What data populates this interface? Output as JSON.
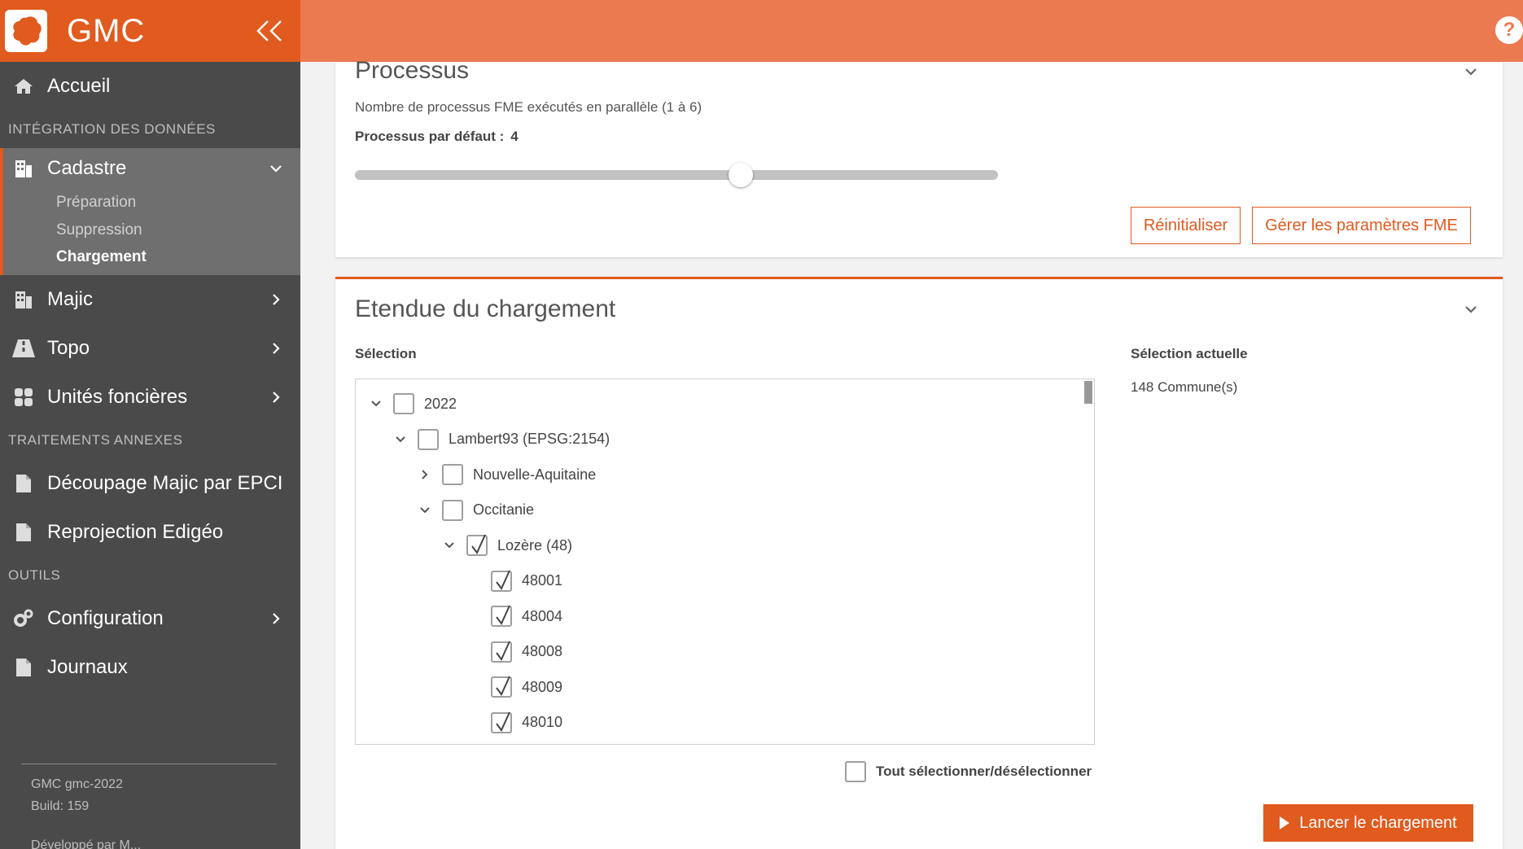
{
  "brand": {
    "name": "GMC"
  },
  "sidebar": {
    "home_label": "Accueil",
    "section_integration": "INTÉGRATION DES DONNÉES",
    "cadastre": {
      "label": "Cadastre",
      "items": [
        {
          "label": "Préparation"
        },
        {
          "label": "Suppression"
        },
        {
          "label": "Chargement"
        }
      ]
    },
    "majic_label": "Majic",
    "topo_label": "Topo",
    "unites_label": "Unités foncières",
    "section_traitements": "TRAITEMENTS ANNEXES",
    "decoupage_label": "Découpage Majic par EPCI",
    "reprojection_label": "Reprojection Edigéo",
    "section_outils": "OUTILS",
    "configuration_label": "Configuration",
    "journaux_label": "Journaux",
    "version_line1": "GMC gmc-2022",
    "version_line2": "Build: 159",
    "cut_text": "Développé par M..."
  },
  "colors": {
    "accent": "#e15a1e",
    "topbar": "#ec7a51",
    "sidebar_bg": "#4a4a4a"
  },
  "processus": {
    "title": "Processus",
    "description": "Nombre de processus FME exécutés en parallèle (1 à 6)",
    "default_label": "Processus par défaut :",
    "default_value": "4",
    "slider": {
      "min": 1,
      "max": 6,
      "value": 4
    },
    "reset_label": "Réinitialiser",
    "manage_label": "Gérer les paramètres FME"
  },
  "etendue": {
    "title": "Etendue du chargement",
    "selection_label": "Sélection",
    "current_label": "Sélection actuelle",
    "current_value": "148 Commune(s)",
    "tree": [
      {
        "label": "2022",
        "level": 0,
        "expand": "down",
        "checked": false
      },
      {
        "label": "Lambert93 (EPSG:2154)",
        "level": 1,
        "expand": "down",
        "checked": false
      },
      {
        "label": "Nouvelle-Aquitaine",
        "level": 2,
        "expand": "right",
        "checked": false
      },
      {
        "label": "Occitanie",
        "level": 2,
        "expand": "down",
        "checked": false
      },
      {
        "label": "Lozère (48)",
        "level": 3,
        "expand": "down",
        "checked": true
      },
      {
        "label": "48001",
        "level": 4,
        "expand": "none",
        "checked": true
      },
      {
        "label": "48004",
        "level": 4,
        "expand": "none",
        "checked": true
      },
      {
        "label": "48008",
        "level": 4,
        "expand": "none",
        "checked": true
      },
      {
        "label": "48009",
        "level": 4,
        "expand": "none",
        "checked": true
      },
      {
        "label": "48010",
        "level": 4,
        "expand": "none",
        "checked": true
      }
    ],
    "select_all_label": "Tout sélectionner/désélectionner",
    "launch_label": "Lancer le chargement"
  }
}
